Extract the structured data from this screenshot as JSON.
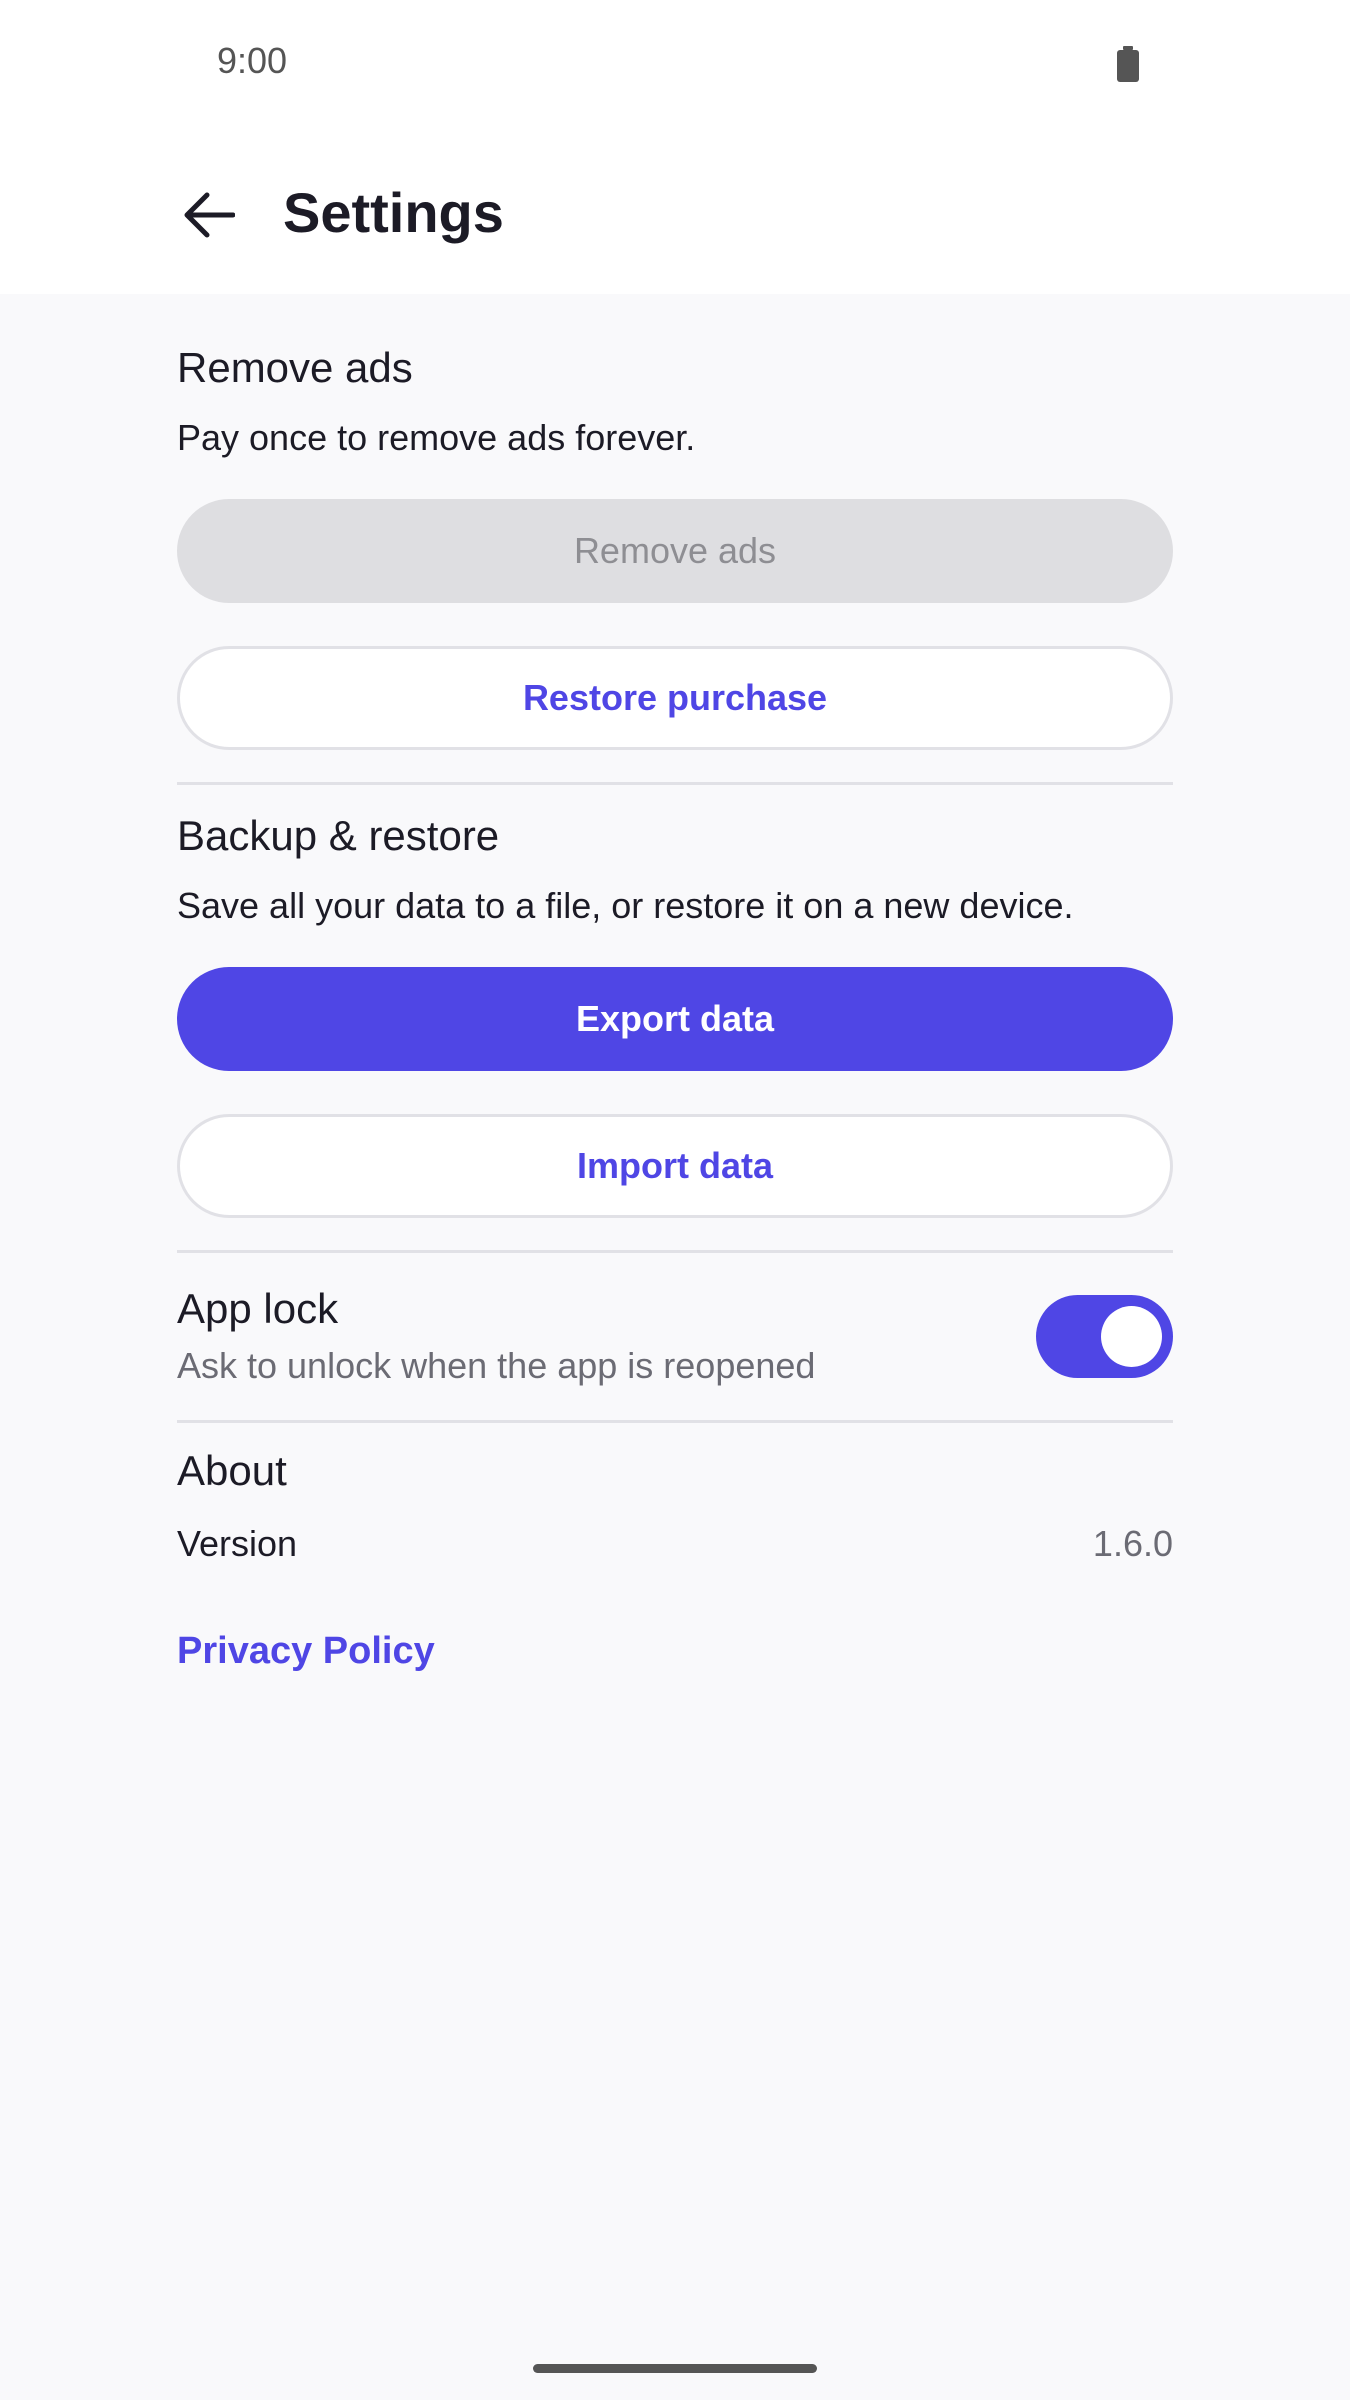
{
  "status_bar": {
    "time": "9:00"
  },
  "header": {
    "title": "Settings",
    "back_icon": "arrow-left-icon"
  },
  "remove_ads": {
    "title": "Remove ads",
    "description": "Pay once to remove ads forever.",
    "remove_button_label": "Remove ads",
    "restore_button_label": "Restore purchase"
  },
  "backup": {
    "title": "Backup & restore",
    "description": "Save all your data to a file, or restore it on a new device.",
    "export_button_label": "Export data",
    "import_button_label": "Import data"
  },
  "app_lock": {
    "title": "App lock",
    "description": "Ask to unlock when the app is reopened",
    "enabled": true
  },
  "about": {
    "title": "About",
    "version_label": "Version",
    "version_value": "1.6.0",
    "privacy_link": "Privacy Policy"
  },
  "colors": {
    "accent": "#4f46e5",
    "background": "#f9f9fb",
    "disabled": "#dedee1"
  }
}
